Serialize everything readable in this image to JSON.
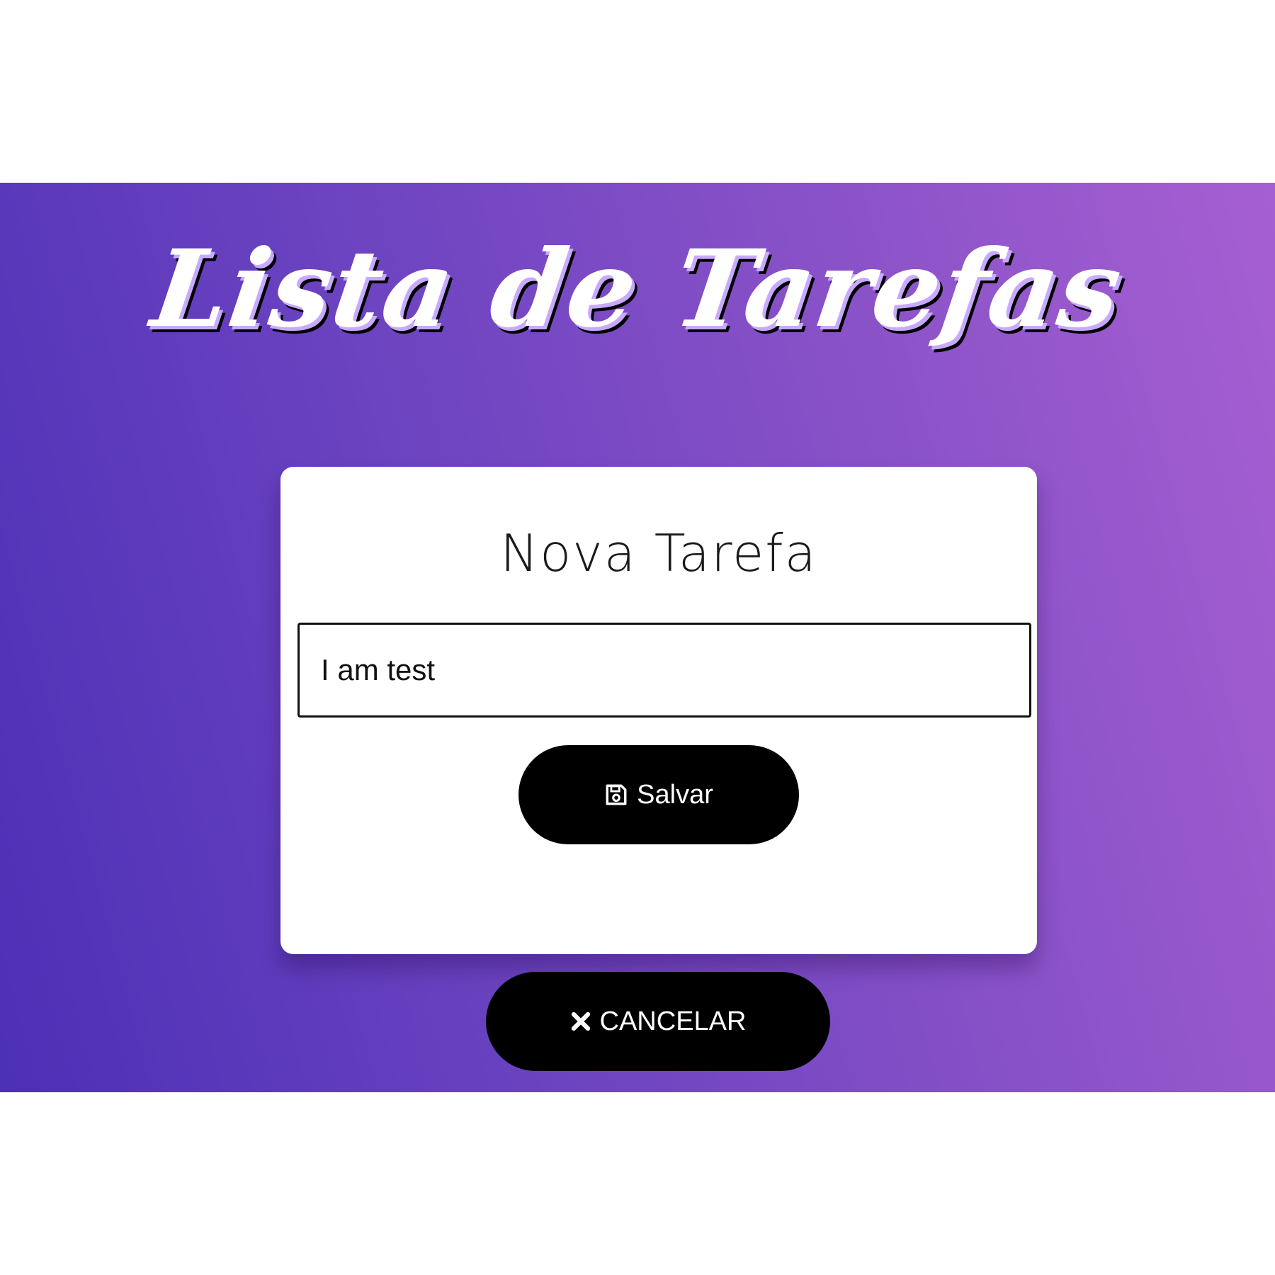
{
  "app": {
    "title": "Lista de Tarefas"
  },
  "form": {
    "title": "Nova Tarefa",
    "input_value": "I am test",
    "save_label": "Salvar",
    "save_icon": "save-icon"
  },
  "actions": {
    "cancel_label": "CANCELAR",
    "cancel_icon": "close-icon"
  },
  "colors": {
    "gradient_start": "#4c30b6",
    "gradient_end": "#a65fd2",
    "button_bg": "#000000",
    "button_text": "#ffffff"
  }
}
